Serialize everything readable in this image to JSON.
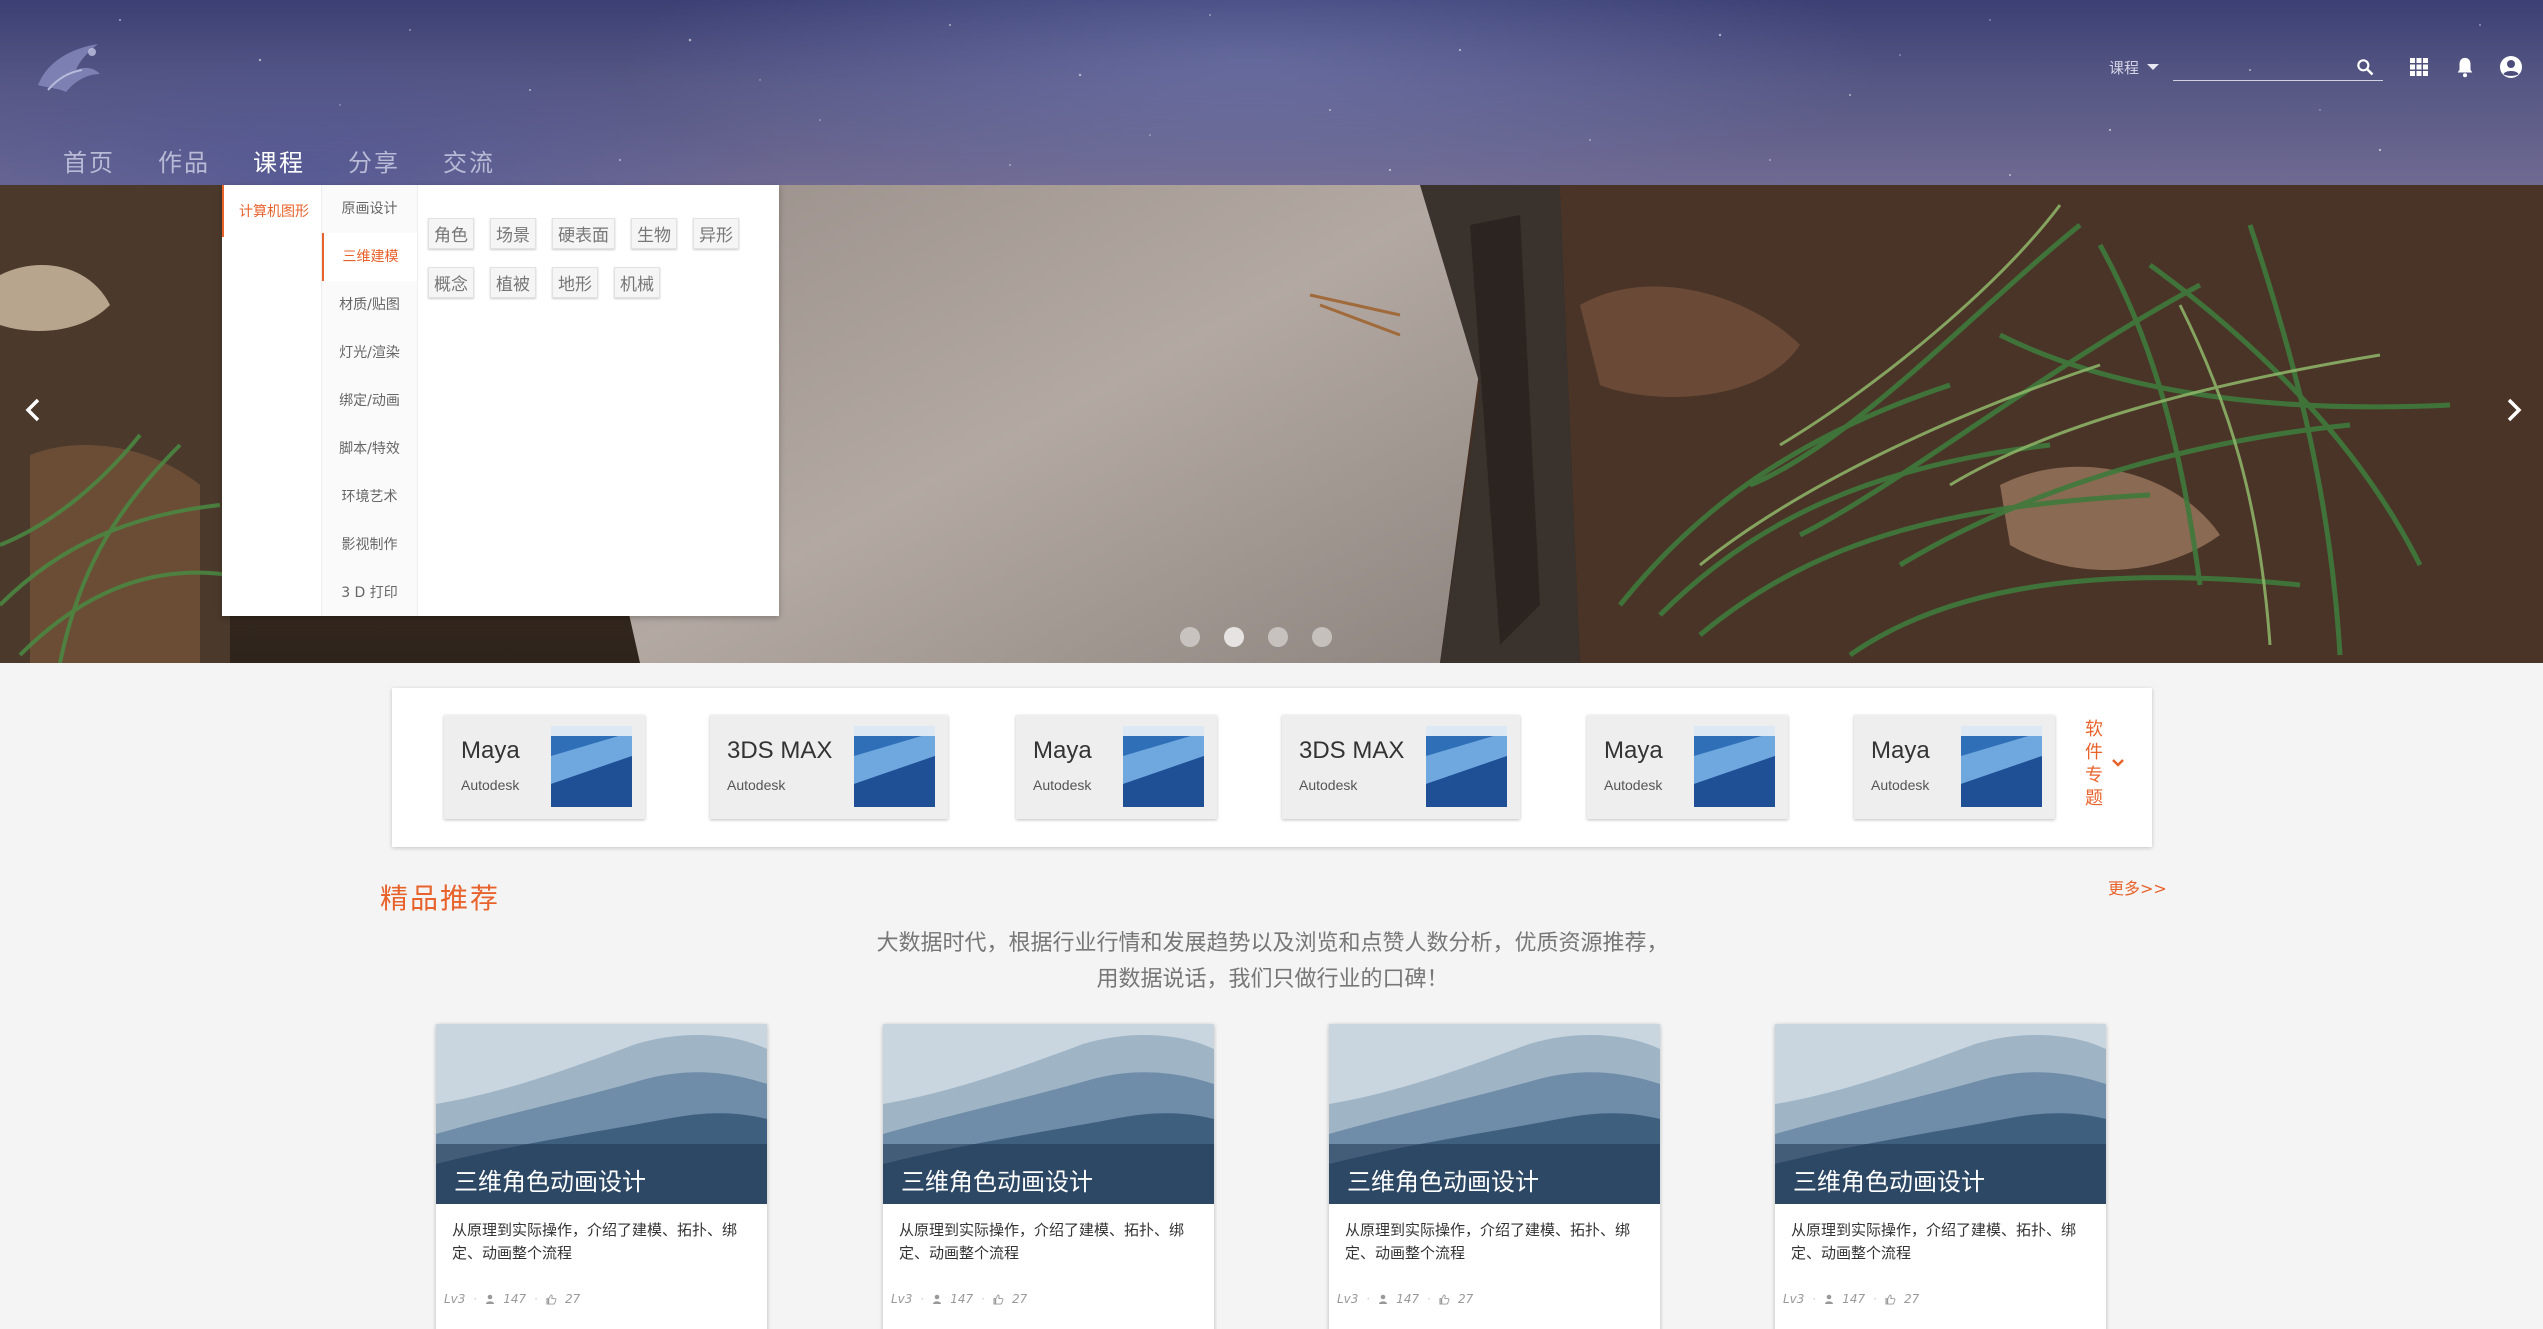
{
  "nav": {
    "items": [
      "首页",
      "作品",
      "课程",
      "分享",
      "交流"
    ],
    "active_index": 2
  },
  "search": {
    "category": "课程",
    "query": ""
  },
  "mega_menu": {
    "level1": [
      "计算机图形"
    ],
    "level2": [
      "原画设计",
      "三维建模",
      "材质/贴图",
      "灯光/渲染",
      "绑定/动画",
      "脚本/特效",
      "环境艺术",
      "影视制作",
      "3 D 打印"
    ],
    "level2_active_index": 1,
    "tags": [
      "角色",
      "场景",
      "硬表面",
      "生物",
      "异形",
      "概念",
      "植被",
      "地形",
      "机械"
    ]
  },
  "carousel": {
    "slide_count": 4,
    "active_index": 1
  },
  "software": {
    "cards": [
      {
        "name": "Maya",
        "vendor": "Autodesk"
      },
      {
        "name": "3DS MAX",
        "vendor": "Autodesk"
      },
      {
        "name": "Maya",
        "vendor": "Autodesk"
      },
      {
        "name": "3DS MAX",
        "vendor": "Autodesk"
      },
      {
        "name": "Maya",
        "vendor": "Autodesk"
      },
      {
        "name": "Maya",
        "vendor": "Autodesk"
      }
    ],
    "more_label": "软件专题"
  },
  "featured": {
    "title": "精品推荐",
    "more": "更多>>",
    "description_line1": "大数据时代，根据行业行情和发展趋势以及浏览和点赞人数分析，优质资源推荐，",
    "description_line2": "用数据说话，我们只做行业的口碑！",
    "courses": [
      {
        "title": "三维角色动画设计",
        "desc": "从原理到实际操作，介绍了建模、拓扑、绑定、动画整个流程",
        "level": "Lv3",
        "students": "147",
        "likes": "27"
      },
      {
        "title": "三维角色动画设计",
        "desc": "从原理到实际操作，介绍了建模、拓扑、绑定、动画整个流程",
        "level": "Lv3",
        "students": "147",
        "likes": "27"
      },
      {
        "title": "三维角色动画设计",
        "desc": "从原理到实际操作，介绍了建模、拓扑、绑定、动画整个流程",
        "level": "Lv3",
        "students": "147",
        "likes": "27"
      },
      {
        "title": "三维角色动画设计",
        "desc": "从原理到实际操作，介绍了建模、拓扑、绑定、动画整个流程",
        "level": "Lv3",
        "students": "147",
        "likes": "27"
      }
    ]
  },
  "colors": {
    "accent": "#e8632b",
    "header_bg": "#4a4c7c"
  },
  "icons": {
    "search": "search-icon",
    "apps": "apps-grid-icon",
    "notifications": "bell-icon",
    "account": "account-circle-icon",
    "prev": "chevron-left-icon",
    "next": "chevron-right-icon",
    "more": "chevron-down-icon"
  }
}
